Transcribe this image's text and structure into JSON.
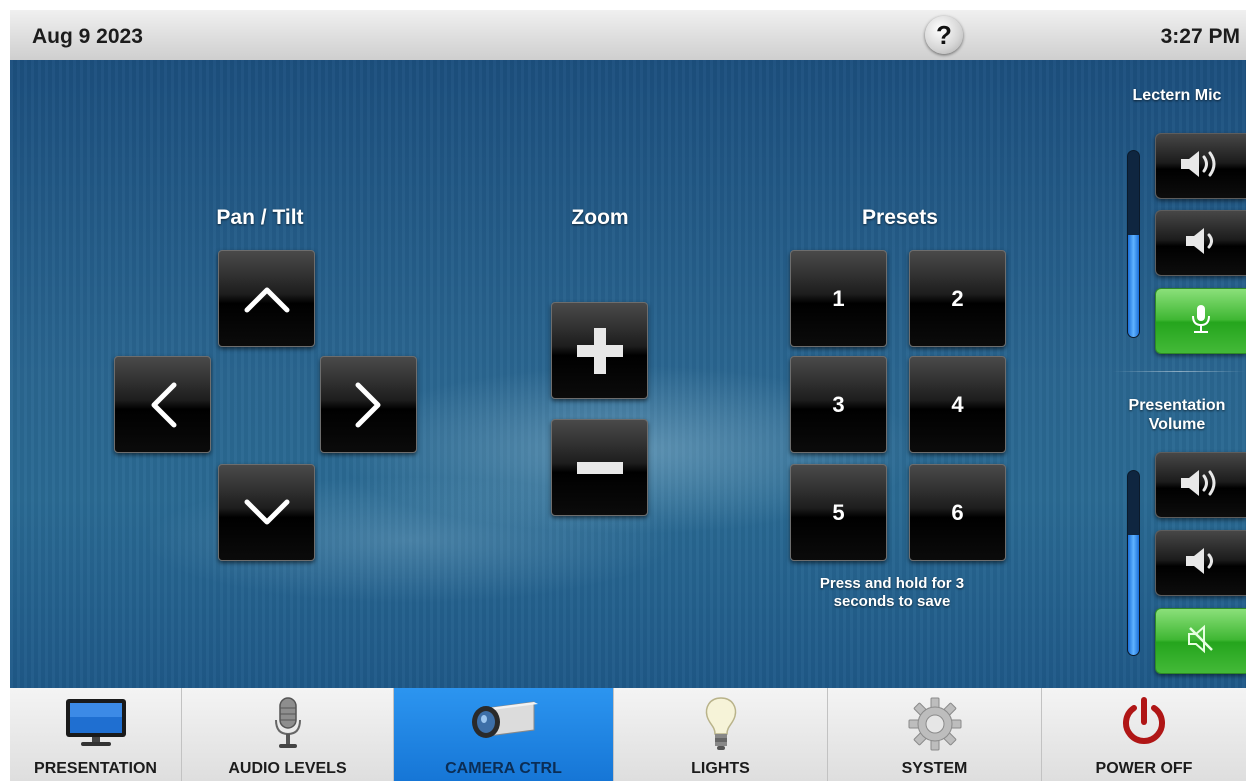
{
  "header": {
    "date": "Aug 9 2023",
    "time": "3:27 PM",
    "help_symbol": "?"
  },
  "pan_tilt": {
    "title": "Pan / Tilt",
    "icons": [
      "chevron-up-icon",
      "chevron-left-icon",
      "chevron-right-icon",
      "chevron-down-icon"
    ]
  },
  "zoom": {
    "title": "Zoom",
    "icons": [
      "plus-icon",
      "minus-icon"
    ]
  },
  "presets": {
    "title": "Presets",
    "buttons": [
      "1",
      "2",
      "3",
      "4",
      "5",
      "6"
    ],
    "hint_line1": "Press and hold for 3",
    "hint_line2": "seconds to save"
  },
  "audio": {
    "lectern_mic": {
      "label": "Lectern Mic",
      "level": 0.55,
      "icons": [
        "volume-up-icon",
        "volume-down-icon",
        "microphone-icon"
      ]
    },
    "presentation_volume": {
      "label_line1": "Presentation",
      "label_line2": "Volume",
      "level": 0.65,
      "icons": [
        "volume-up-icon",
        "volume-down-icon",
        "mute-icon"
      ]
    },
    "colors": {
      "active_green": "#3fb733",
      "meter_blue": "#3a8fef"
    }
  },
  "nav": {
    "active_color": "#1c82e0",
    "items": [
      {
        "label": "PRESENTATION",
        "icon": "monitor-icon"
      },
      {
        "label": "AUDIO LEVELS",
        "icon": "microphone-icon"
      },
      {
        "label": "CAMERA CTRL",
        "icon": "camera-icon",
        "active": true
      },
      {
        "label": "LIGHTS",
        "icon": "lightbulb-icon"
      },
      {
        "label": "SYSTEM",
        "icon": "gear-icon"
      },
      {
        "label": "POWER OFF",
        "icon": "power-icon"
      }
    ]
  }
}
